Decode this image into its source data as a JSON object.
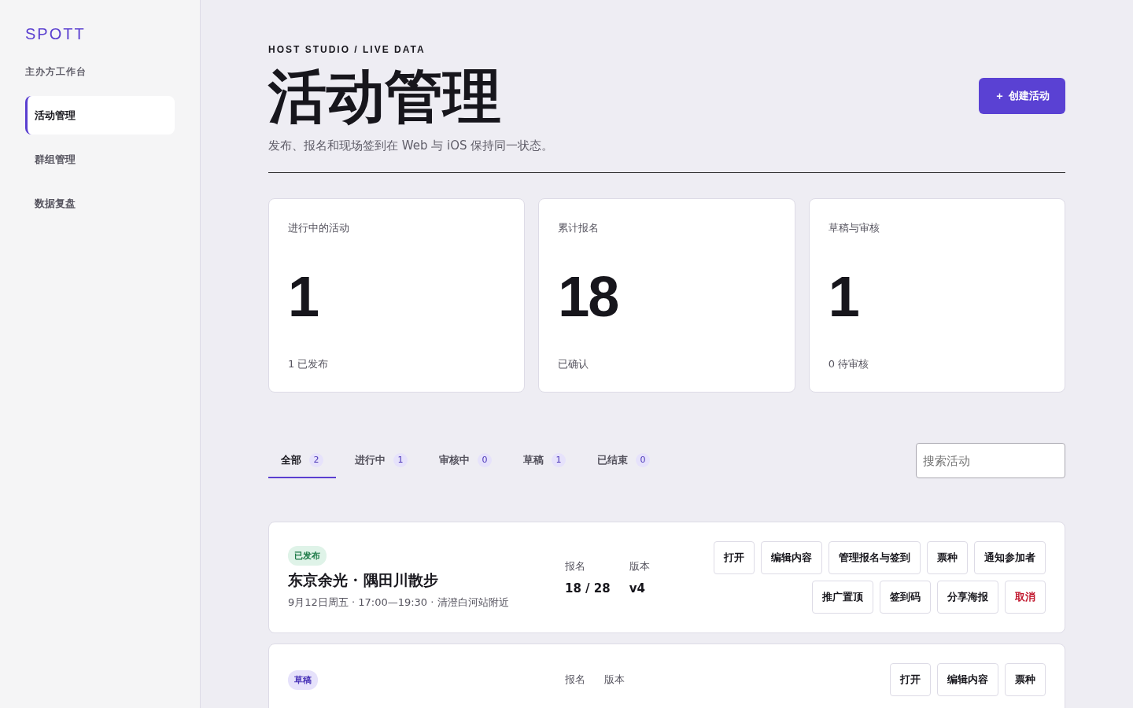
{
  "sidebar": {
    "logo": "SPOTT",
    "section": "主办方工作台",
    "items": [
      {
        "label": "活动管理",
        "selected": true
      },
      {
        "label": "群组管理",
        "selected": false
      },
      {
        "label": "数据复盘",
        "selected": false
      }
    ]
  },
  "header": {
    "eyebrow": "HOST STUDIO / LIVE DATA",
    "title": "活动管理",
    "subtitle": "发布、报名和现场签到在 Web 与 iOS 保持同一状态。",
    "create_button": "＋ 创建活动"
  },
  "stats": [
    {
      "label": "进行中的活动",
      "value": "1",
      "note": "1 已发布"
    },
    {
      "label": "累计报名",
      "value": "18",
      "note": "已确认"
    },
    {
      "label": "草稿与审核",
      "value": "1",
      "note": "0 待审核"
    }
  ],
  "tabs": [
    {
      "label": "全部",
      "count": "2",
      "selected": true
    },
    {
      "label": "进行中",
      "count": "1",
      "selected": false
    },
    {
      "label": "审核中",
      "count": "0",
      "selected": false
    },
    {
      "label": "草稿",
      "count": "1",
      "selected": false
    },
    {
      "label": "已结束",
      "count": "0",
      "selected": false
    }
  ],
  "search": {
    "placeholder": "搜索活动"
  },
  "events": [
    {
      "status": "已发布",
      "kind": "published",
      "title": "东京余光 · 隅田川散步",
      "meta": "9月12日周五 · 17:00—19:30 · 清澄白河站附近",
      "signup_label": "报名",
      "signup": "18 / 28",
      "version_label": "版本",
      "version": "v4",
      "actions": [
        {
          "label": "打开",
          "kind": "normal"
        },
        {
          "label": "编辑内容",
          "kind": "normal"
        },
        {
          "label": "管理报名与签到",
          "kind": "normal"
        },
        {
          "label": "票种",
          "kind": "normal"
        },
        {
          "label": "通知参加者",
          "kind": "normal"
        },
        {
          "label": "推广置顶",
          "kind": "normal"
        },
        {
          "label": "签到码",
          "kind": "normal"
        },
        {
          "label": "分享海报",
          "kind": "normal"
        },
        {
          "label": "取消",
          "kind": "danger"
        }
      ]
    },
    {
      "status": "草稿",
      "kind": "draft",
      "signup_label": "报名",
      "version_label": "版本",
      "actions": [
        {
          "label": "打开",
          "kind": "normal"
        },
        {
          "label": "编辑内容",
          "kind": "normal"
        },
        {
          "label": "票种",
          "kind": "normal"
        }
      ]
    }
  ]
}
